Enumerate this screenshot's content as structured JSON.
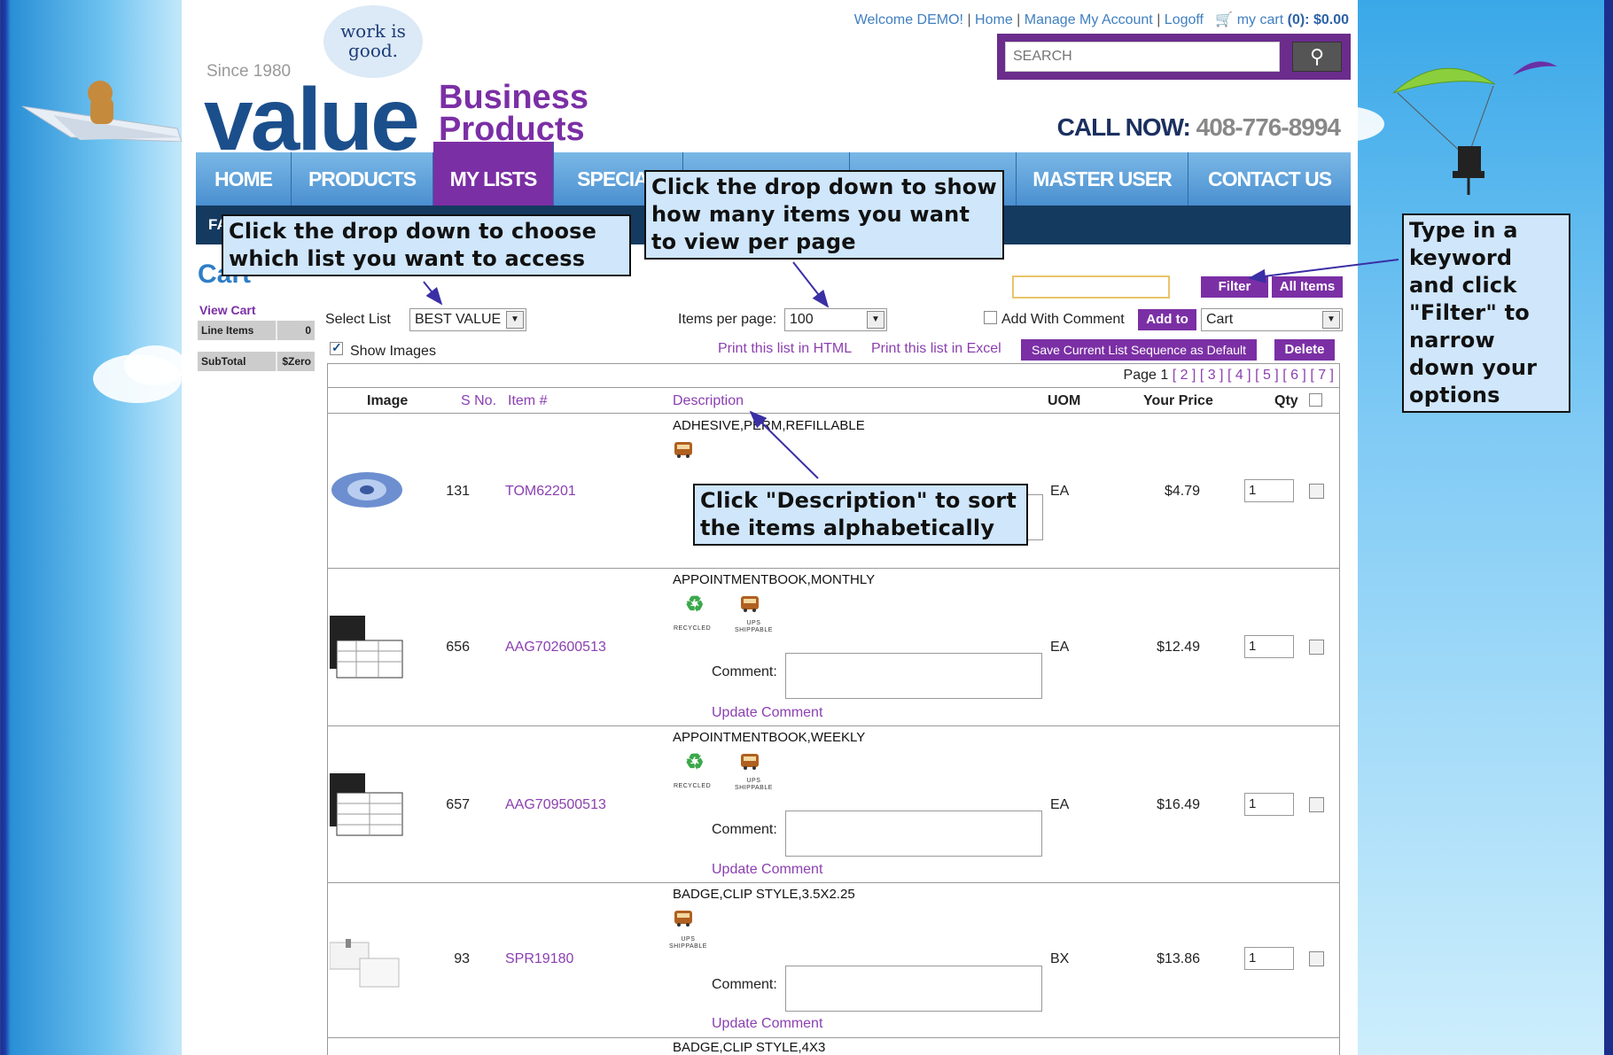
{
  "header": {
    "welcome": "Welcome DEMO!",
    "home_link": "Home",
    "manage_link": "Manage My Account",
    "logoff_link": "Logoff",
    "cart_label": "my cart",
    "cart_summary": "(0): $0.00",
    "search_placeholder": "SEARCH",
    "since": "Since 1980",
    "tagline": "work is good.",
    "logo_main": "value",
    "logo_sub1": "Business",
    "logo_sub2": "Products",
    "call_label": "CALL NOW:",
    "phone": "408-776-8994"
  },
  "nav": {
    "items": [
      "HOME",
      "PRODUCTS",
      "MY LISTS",
      "SPECIAL",
      "",
      "",
      "MASTER USER",
      "CONTACT US"
    ],
    "active_index": 2,
    "subnav_label": "FA"
  },
  "sidebar": {
    "title": "Cart",
    "view_cart": "View Cart",
    "line_items_label": "Line Items",
    "line_items_value": "0",
    "subtotal_label": "SubTotal",
    "subtotal_value": "$Zero"
  },
  "controls": {
    "select_list_label": "Select List",
    "select_list_value": "BEST VALUE",
    "items_per_page_label": "Items per page:",
    "items_per_page_value": "100",
    "add_with_comment": "Add With Comment",
    "add_to_button": "Add to",
    "add_to_target": "Cart",
    "filter_button": "Filter",
    "all_items_button": "All Items",
    "show_images": "Show Images",
    "print_html": "Print this list in HTML",
    "print_excel": "Print this list in Excel",
    "save_sequence": "Save Current List Sequence as Default",
    "delete_button": "Delete"
  },
  "pager": {
    "label": "Page 1",
    "pages": "[ 2 ] [ 3 ] [ 4 ] [ 5 ] [ 6 ] [ 7 ]"
  },
  "table": {
    "headers": {
      "image": "Image",
      "sno": "S No.",
      "item": "Item #",
      "description": "Description",
      "uom": "UOM",
      "price": "Your Price",
      "qty": "Qty"
    },
    "comment_label": "Comment:",
    "update_comment": "Update Comment",
    "recycled_label": "RECYCLED",
    "ups_label_1": "UPS",
    "ups_label_2": "SHIPPABLE",
    "rows": [
      {
        "description": "ADHESIVE,PERM,REFILLABLE",
        "sno": "131",
        "item": "TOM62201",
        "uom": "EA",
        "price": "$4.79",
        "qty": "1"
      },
      {
        "description": "APPOINTMENTBOOK,MONTHLY",
        "sno": "656",
        "item": "AAG702600513",
        "uom": "EA",
        "price": "$12.49",
        "qty": "1"
      },
      {
        "description": "APPOINTMENTBOOK,WEEKLY",
        "sno": "657",
        "item": "AAG709500513",
        "uom": "EA",
        "price": "$16.49",
        "qty": "1"
      },
      {
        "description": "BADGE,CLIP STYLE,3.5X2.25",
        "sno": "93",
        "item": "SPR19180",
        "uom": "BX",
        "price": "$13.86",
        "qty": "1"
      },
      {
        "description": "BADGE,CLIP STYLE,4X3"
      }
    ]
  },
  "callouts": {
    "choose_list": "Click the drop down to choose which list you want to access",
    "items_per_page": "Click the drop down to show how many items you want to view per page",
    "filter": "Type in a keyword and click \"Filter\" to narrow down your options",
    "description": "Click \"Description\" to sort the items alphabetically"
  },
  "colors": {
    "accent_purple": "#7b2fa5",
    "nav_blue": "#4a8fd0",
    "callout_bg": "#cfe6fb"
  }
}
